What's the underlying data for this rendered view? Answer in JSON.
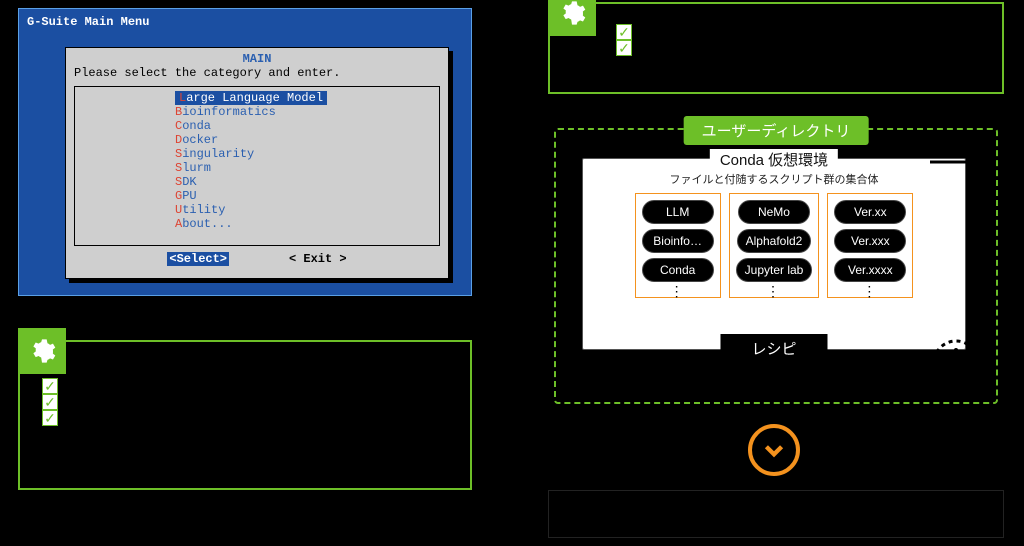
{
  "terminal": {
    "window_title": "G-Suite Main Menu",
    "dialog_header": "MAIN",
    "prompt": "Please select the category and enter.",
    "menu": [
      {
        "hotkey": "L",
        "rest": "arge Language Model",
        "selected": true
      },
      {
        "hotkey": "B",
        "rest": "ioinformatics",
        "selected": false
      },
      {
        "hotkey": "C",
        "rest": "onda",
        "selected": false
      },
      {
        "hotkey": "D",
        "rest": "ocker",
        "selected": false
      },
      {
        "hotkey": "S",
        "rest": "ingularity",
        "selected": false
      },
      {
        "hotkey": "S",
        "rest": "lurm",
        "selected": false
      },
      {
        "hotkey": "S",
        "rest": "DK",
        "selected": false
      },
      {
        "hotkey": "G",
        "rest": "PU",
        "selected": false
      },
      {
        "hotkey": "U",
        "rest": "tility",
        "selected": false
      },
      {
        "hotkey": "A",
        "rest": "bout...",
        "selected": false
      }
    ],
    "btn_select": "<Select>",
    "btn_exit": "< Exit >"
  },
  "panel1": {
    "items": [
      "",
      "",
      ""
    ]
  },
  "panel2": {
    "items": [
      "",
      ""
    ]
  },
  "userdir": {
    "label": "ユーザーディレクトリ",
    "conda_title": "Conda 仮想環境",
    "conda_sub": "ファイルと付随するスクリプト群の集合体",
    "groups": [
      [
        "LLM",
        "Bioinfo…",
        "Conda"
      ],
      [
        "NeMo",
        "Alphafold2",
        "Jupyter lab"
      ],
      [
        "Ver.xx",
        "Ver.xxx",
        "Ver.xxxx"
      ]
    ],
    "recipe_label": "レシピ"
  },
  "icons": {
    "gear": "gear-icon",
    "check": "✓",
    "vdots": "⋮",
    "download": "download-icon",
    "chevron_down": "chevron-down-icon"
  },
  "colors": {
    "green": "#6dbf28",
    "orange": "#f4921e",
    "terminal_blue": "#1b4fa2"
  }
}
